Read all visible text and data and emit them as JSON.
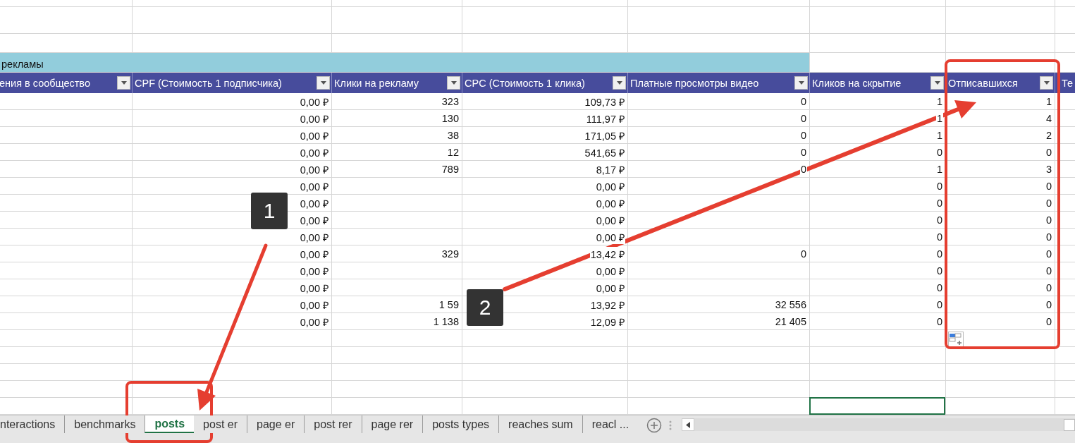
{
  "group_header": "рекламы",
  "columns": [
    {
      "label": "ения в сообщество",
      "filter": true
    },
    {
      "label": "CPF (Стоимость 1 подписчика)",
      "filter": true
    },
    {
      "label": "Клики на рекламу",
      "filter": true
    },
    {
      "label": "CPC (Стоимость 1 клика)",
      "filter": true
    },
    {
      "label": "Платные просмотры видео",
      "filter": true
    },
    {
      "label": "Кликов на скрытие",
      "filter": true
    },
    {
      "label": "Отписавшихся",
      "filter": true
    },
    {
      "label": "Те",
      "filter": false
    }
  ],
  "rows": [
    {
      "cells": [
        null,
        "0,00 ₽",
        "323",
        "109,73 ₽",
        "0",
        "1",
        "1",
        null
      ]
    },
    {
      "cells": [
        null,
        "0,00 ₽",
        "130",
        "111,97 ₽",
        "0",
        "1",
        "4",
        null
      ]
    },
    {
      "cells": [
        null,
        "0,00 ₽",
        "38",
        "171,05 ₽",
        "0",
        "1",
        "2",
        null
      ]
    },
    {
      "cells": [
        null,
        "0,00 ₽",
        "12",
        "541,65 ₽",
        "0",
        "0",
        "0",
        null
      ]
    },
    {
      "cells": [
        null,
        "0,00 ₽",
        "789",
        "8,17 ₽",
        "0",
        "1",
        "3",
        null
      ]
    },
    {
      "cells": [
        null,
        "0,00 ₽",
        null,
        "0,00 ₽",
        null,
        "0",
        "0",
        null
      ]
    },
    {
      "cells": [
        null,
        "0,00 ₽",
        null,
        "0,00 ₽",
        null,
        "0",
        "0",
        null
      ]
    },
    {
      "cells": [
        null,
        "0,00 ₽",
        null,
        "0,00 ₽",
        null,
        "0",
        "0",
        null
      ]
    },
    {
      "cells": [
        null,
        "0,00 ₽",
        null,
        "0,00 ₽",
        null,
        "0",
        "0",
        null
      ]
    },
    {
      "cells": [
        null,
        "0,00 ₽",
        "329",
        "13,42 ₽",
        "0",
        "0",
        "0",
        null
      ]
    },
    {
      "cells": [
        null,
        "0,00 ₽",
        null,
        "0,00 ₽",
        null,
        "0",
        "0",
        null
      ]
    },
    {
      "cells": [
        null,
        "0,00 ₽",
        null,
        "0,00 ₽",
        null,
        "0",
        "0",
        null
      ]
    },
    {
      "cells": [
        null,
        "0,00 ₽",
        "1 59",
        "13,92 ₽",
        "32 556",
        "0",
        "0",
        null
      ]
    },
    {
      "cells": [
        null,
        "0,00 ₽",
        "1 138",
        "12,09 ₽",
        "21 405",
        "0",
        "0",
        null
      ]
    }
  ],
  "blank_rows": [
    {
      "selected_cells": [
        false,
        false,
        false,
        false,
        false,
        false,
        false,
        false
      ]
    },
    {
      "selected_cells": [
        false,
        false,
        false,
        false,
        false,
        false,
        false,
        false
      ]
    },
    {
      "selected_cells": [
        false,
        false,
        false,
        false,
        false,
        false,
        false,
        false
      ]
    },
    {
      "selected_cells": [
        false,
        false,
        false,
        false,
        false,
        false,
        false,
        false
      ]
    },
    {
      "selected_cells": [
        false,
        false,
        false,
        false,
        false,
        true,
        false,
        false
      ]
    }
  ],
  "tabs": [
    {
      "label": "nteractions",
      "selected": false
    },
    {
      "label": "benchmarks",
      "selected": false
    },
    {
      "label": "posts",
      "selected": true
    },
    {
      "label": "post er",
      "selected": false
    },
    {
      "label": "page er",
      "selected": false
    },
    {
      "label": "post rer",
      "selected": false
    },
    {
      "label": "page rer",
      "selected": false
    },
    {
      "label": "posts types",
      "selected": false
    },
    {
      "label": "reaches sum",
      "selected": false
    },
    {
      "label": "reacl ...",
      "selected": false
    }
  ],
  "annotations": [
    {
      "label": "1"
    },
    {
      "label": "2"
    }
  ]
}
